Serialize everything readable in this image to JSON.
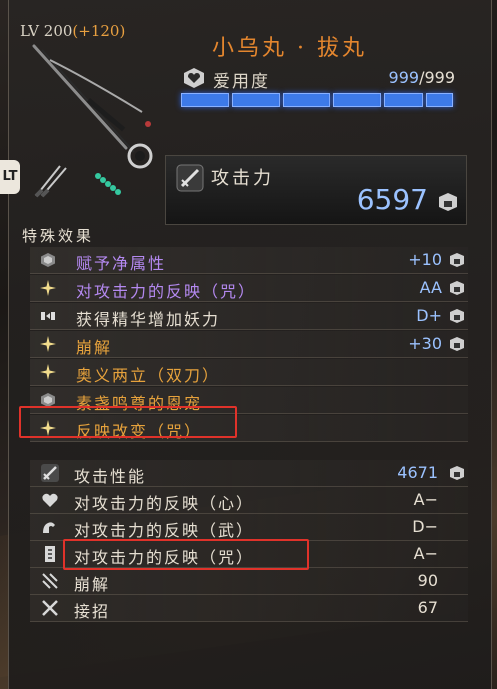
{
  "header": {
    "level_label": "LV 200",
    "level_bonus": "(+120)",
    "weapon_name": "小乌丸 · 拔丸"
  },
  "affinity": {
    "label": "爱用度",
    "value": "999",
    "max": "/999",
    "bar_fill_percent": 100,
    "segments": 6
  },
  "side_badge": "LT",
  "attack": {
    "label": "攻击力",
    "value": "6597"
  },
  "special_effects": {
    "title": "特殊效果",
    "items": [
      {
        "name": "赋予净属性",
        "value": "+10",
        "color": "#b489f0",
        "icon": "hex-gem-icon"
      },
      {
        "name": "对攻击力的反映（咒）",
        "value": "AA",
        "color": "#b489f0",
        "icon": "star-spark-icon"
      },
      {
        "name": "获得精华增加妖力",
        "value": "D+",
        "color": "#e6dfd2",
        "icon": "ribbon-icon"
      },
      {
        "name": "崩解",
        "value": "+30",
        "color": "#e6a23c",
        "icon": "star-spark-icon"
      },
      {
        "name": "奥义两立（双刀）",
        "value": "",
        "color": "#e6a23c",
        "icon": "star-spark-icon"
      },
      {
        "name": "素盏鸣尊的恩宠",
        "value": "",
        "color": "#e6a23c",
        "icon": "hex-gem-icon"
      },
      {
        "name": "反映改变（咒）",
        "value": "",
        "color": "#e6a23c",
        "icon": "star-spark-icon"
      }
    ]
  },
  "stats": [
    {
      "name": "攻击性能",
      "value": "4671",
      "icon": "sword-icon"
    },
    {
      "name": "对攻击力的反映（心）",
      "value": "A−",
      "icon": "heart-icon"
    },
    {
      "name": "对攻击力的反映（武）",
      "value": "D−",
      "icon": "arm-icon"
    },
    {
      "name": "对攻击力的反映（咒）",
      "value": "A−",
      "icon": "talisman-icon"
    },
    {
      "name": "崩解",
      "value": "90",
      "icon": "break-icon"
    },
    {
      "name": "接招",
      "value": "67",
      "icon": "cross-swords-icon"
    }
  ],
  "colors": {
    "accent_orange": "#e4862e",
    "blue_value": "#9bc2ff",
    "highlight_red": "#e0322a"
  }
}
